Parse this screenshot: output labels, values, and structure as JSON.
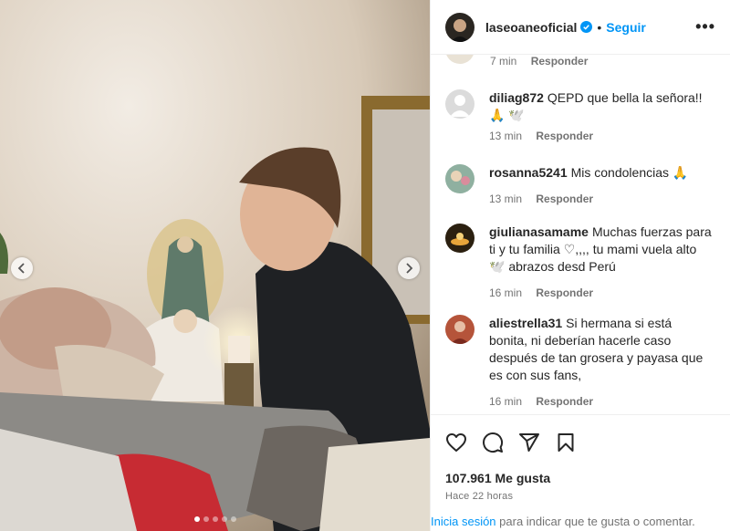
{
  "post": {
    "username": "laseoaneoficial",
    "follow_label": "Seguir",
    "separator": "•",
    "more_label": "•••",
    "image_dots": 5,
    "active_dot": 0
  },
  "comments": {
    "partial": {
      "time": "7 min",
      "reply": "Responder"
    },
    "items": [
      {
        "user": "diliag872",
        "text": "QEPD que bella la señora!!🙏 🕊️",
        "time": "13 min",
        "reply": "Responder",
        "avatar_color": "#c7c7c7"
      },
      {
        "user": "rosanna5241",
        "text": "Mis condolencias 🙏",
        "time": "13 min",
        "reply": "Responder",
        "avatar_color": "#8fb0a0"
      },
      {
        "user": "giulianasamame",
        "text": "Muchas fuerzas para ti y tu familia ♡,,,, tu mami vuela alto 🕊️ abrazos desd Perú",
        "time": "16 min",
        "reply": "Responder",
        "avatar_color": "#2b2010"
      },
      {
        "user": "aliestrella31",
        "text": "Si hermana si está bonita, ni deberían hacerle caso después de tan grosera y payasa que es con sus fans,",
        "time": "16 min",
        "reply": "Responder",
        "avatar_color": "#b5543a"
      }
    ]
  },
  "stats": {
    "likes": "107.961 Me gusta",
    "posted": "Hace 22 horas"
  },
  "footer": {
    "login_link": "Inicia sesión",
    "login_rest": " para indicar que te gusta o comentar."
  },
  "colors": {
    "accent": "#0095f6",
    "muted": "#737373",
    "text": "#262626"
  },
  "icons": [
    "chevron-left-icon",
    "chevron-right-icon",
    "verified-icon",
    "heart-icon",
    "comment-icon",
    "share-icon",
    "bookmark-icon"
  ]
}
